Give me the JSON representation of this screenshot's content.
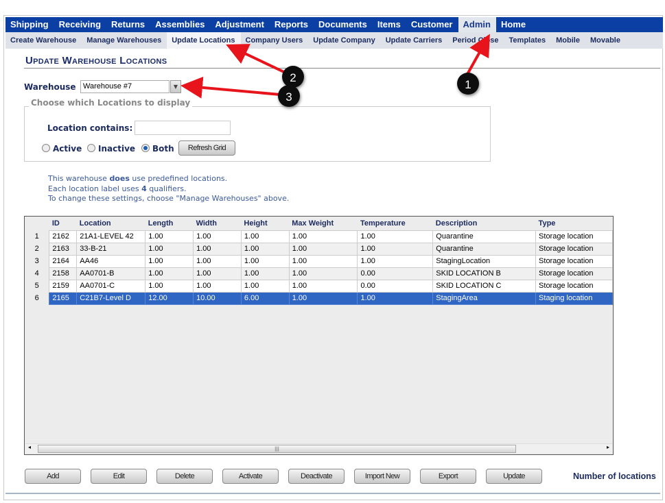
{
  "nav": {
    "items": [
      "Shipping",
      "Receiving",
      "Returns",
      "Assemblies",
      "Adjustment",
      "Reports",
      "Documents",
      "Items",
      "Customer",
      "Admin",
      "Home"
    ],
    "active": "Admin"
  },
  "subnav": {
    "items": [
      "Create Warehouse",
      "Manage Warehouses",
      "Update Locations",
      "Company Users",
      "Update Company",
      "Update Carriers",
      "Period Close",
      "Templates",
      "Mobile",
      "Movable"
    ],
    "active": "Update Locations"
  },
  "page_title": "Update Warehouse Locations",
  "warehouse": {
    "label": "Warehouse",
    "value": "Warehouse #7"
  },
  "filter": {
    "legend": "Choose which Locations to display",
    "location_label": "Location contains:",
    "location_value": "",
    "radios": [
      "Active",
      "Inactive",
      "Both"
    ],
    "selected": "Both",
    "refresh_label": "Refresh Grid"
  },
  "info": {
    "line1_a": "This warehouse ",
    "line1_b": "does",
    "line1_c": " use predefined locations.",
    "line2_a": "Each location label uses ",
    "line2_b": "4",
    "line2_c": " qualifiers.",
    "line3": "To change these settings, choose \"Manage Warehouses\" above."
  },
  "grid": {
    "columns": [
      "ID",
      "Location",
      "Length",
      "Width",
      "Height",
      "Max Weight",
      "Temperature",
      "Description",
      "Type"
    ],
    "rows": [
      [
        "1",
        "2162",
        "21A1-LEVEL 42",
        "1.00",
        "1.00",
        "1.00",
        "1.00",
        "1.00",
        "Quarantine",
        "Storage location"
      ],
      [
        "2",
        "2163",
        "33-B-21",
        "1.00",
        "1.00",
        "1.00",
        "1.00",
        "1.00",
        "Quarantine",
        "Storage location"
      ],
      [
        "3",
        "2164",
        "AA46",
        "1.00",
        "1.00",
        "1.00",
        "1.00",
        "1.00",
        "StagingLocation",
        "Storage location"
      ],
      [
        "4",
        "2158",
        "AA0701-B",
        "1.00",
        "1.00",
        "1.00",
        "1.00",
        "0.00",
        "SKID LOCATION B",
        "Storage location"
      ],
      [
        "5",
        "2159",
        "AA0701-C",
        "1.00",
        "1.00",
        "1.00",
        "1.00",
        "0.00",
        "SKID LOCATION C",
        "Storage location"
      ],
      [
        "6",
        "2165",
        "C21B7-Level D",
        "12.00",
        "10.00",
        "6.00",
        "1.00",
        "1.00",
        "StagingArea",
        "Staging location"
      ]
    ],
    "selected_row": 6
  },
  "buttons": [
    "Add",
    "Edit",
    "Delete",
    "Activate",
    "Deactivate",
    "Import New",
    "Export",
    "Update"
  ],
  "count_label": "Number of locations",
  "annotations": [
    "1",
    "2",
    "3"
  ],
  "colors": {
    "nav": "#0b3fa3",
    "selected_row": "#2f66c4",
    "arrow": "#e8141c"
  }
}
